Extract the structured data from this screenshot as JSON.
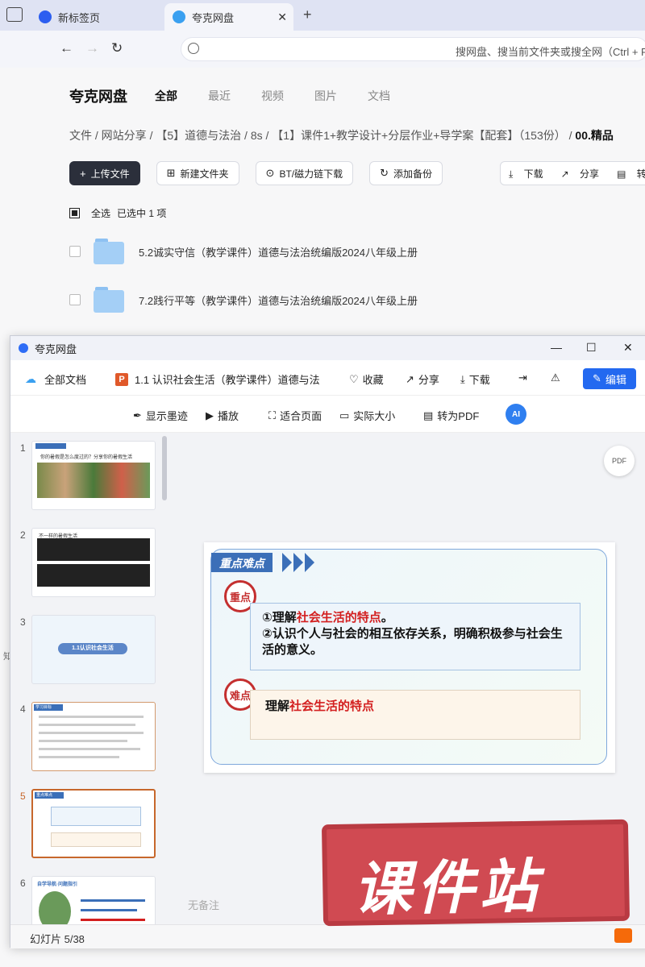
{
  "browser": {
    "tabs": [
      {
        "label": "新标签页",
        "active": false
      },
      {
        "label": "夸克网盘",
        "active": true
      }
    ],
    "omnibox_placeholder": "搜网盘、搜当前文件夹或搜全网（Ctrl + F"
  },
  "page": {
    "brand": "夸克网盘",
    "nav": [
      "全部",
      "最近",
      "视频",
      "图片",
      "文档"
    ],
    "breadcrumbs": [
      "文件",
      "/",
      "网站分享",
      "/",
      "【5】道德与法治",
      "/",
      "8s",
      "/",
      "【1】课件1+教学设计+分层作业+导学案【配套】（153份）",
      "/",
      "00.精品"
    ],
    "toolbar": {
      "upload": "上传文件",
      "new_folder": "新建文件夹",
      "bt": "BT/磁力链下载",
      "backup": "添加备份",
      "download": "下载",
      "share": "分享",
      "convert": "转为"
    },
    "selection": {
      "select_all": "全选",
      "selected_text": "已选中 1 项"
    },
    "files": [
      {
        "name": "5.2诚实守信（教学课件）道德与法治统编版2024八年级上册"
      },
      {
        "name": "7.2践行平等（教学课件）道德与法治统编版2024八年级上册"
      }
    ],
    "side_char": "知"
  },
  "viewer": {
    "title": "夸克网盘",
    "all_docs": "全部文档",
    "doc_title": "1.1 认识社会生活（教学课件）道德与法",
    "ppt_icon": "P",
    "actions": {
      "favorite": "收藏",
      "share": "分享",
      "download": "下载",
      "edit": "编辑"
    },
    "tools": {
      "ink": "显示墨迹",
      "play": "播放",
      "fit": "适合页面",
      "actual": "实际大小",
      "to_pdf": "转为PDF",
      "ai": "AI"
    },
    "thumbnails": [
      {
        "num": "1",
        "caption": "你的暑假是怎么度过的？分享你的暑假生活"
      },
      {
        "num": "2",
        "caption": "不一样的暑假生活"
      },
      {
        "num": "3",
        "caption": "1.1认识社会生活"
      },
      {
        "num": "4",
        "caption": "学习目标"
      },
      {
        "num": "5",
        "caption": "重点难点"
      },
      {
        "num": "6",
        "caption": "自学导航·问题指引"
      }
    ],
    "slide": {
      "header": "重点难点",
      "key_label": "重点",
      "key_line1_prefix": "①理解",
      "key_line1_red": "社会生活的特点",
      "key_line1_suffix": "。",
      "key_line2": "②认识个人与社会的相互依存关系，明确积极参与社会生活的意义。",
      "hard_label": "难点",
      "hard_prefix": "理解",
      "hard_red": "社会生活的特点"
    },
    "pdf_fab": "PDF",
    "notes": "无备注",
    "status": "幻灯片 5/38"
  },
  "watermark": "课件站",
  "colors": {
    "accent": "#2369f0",
    "selected_thumb": "#c7672c",
    "slide_red": "#d31f1f",
    "watermark": "#d04a52"
  }
}
